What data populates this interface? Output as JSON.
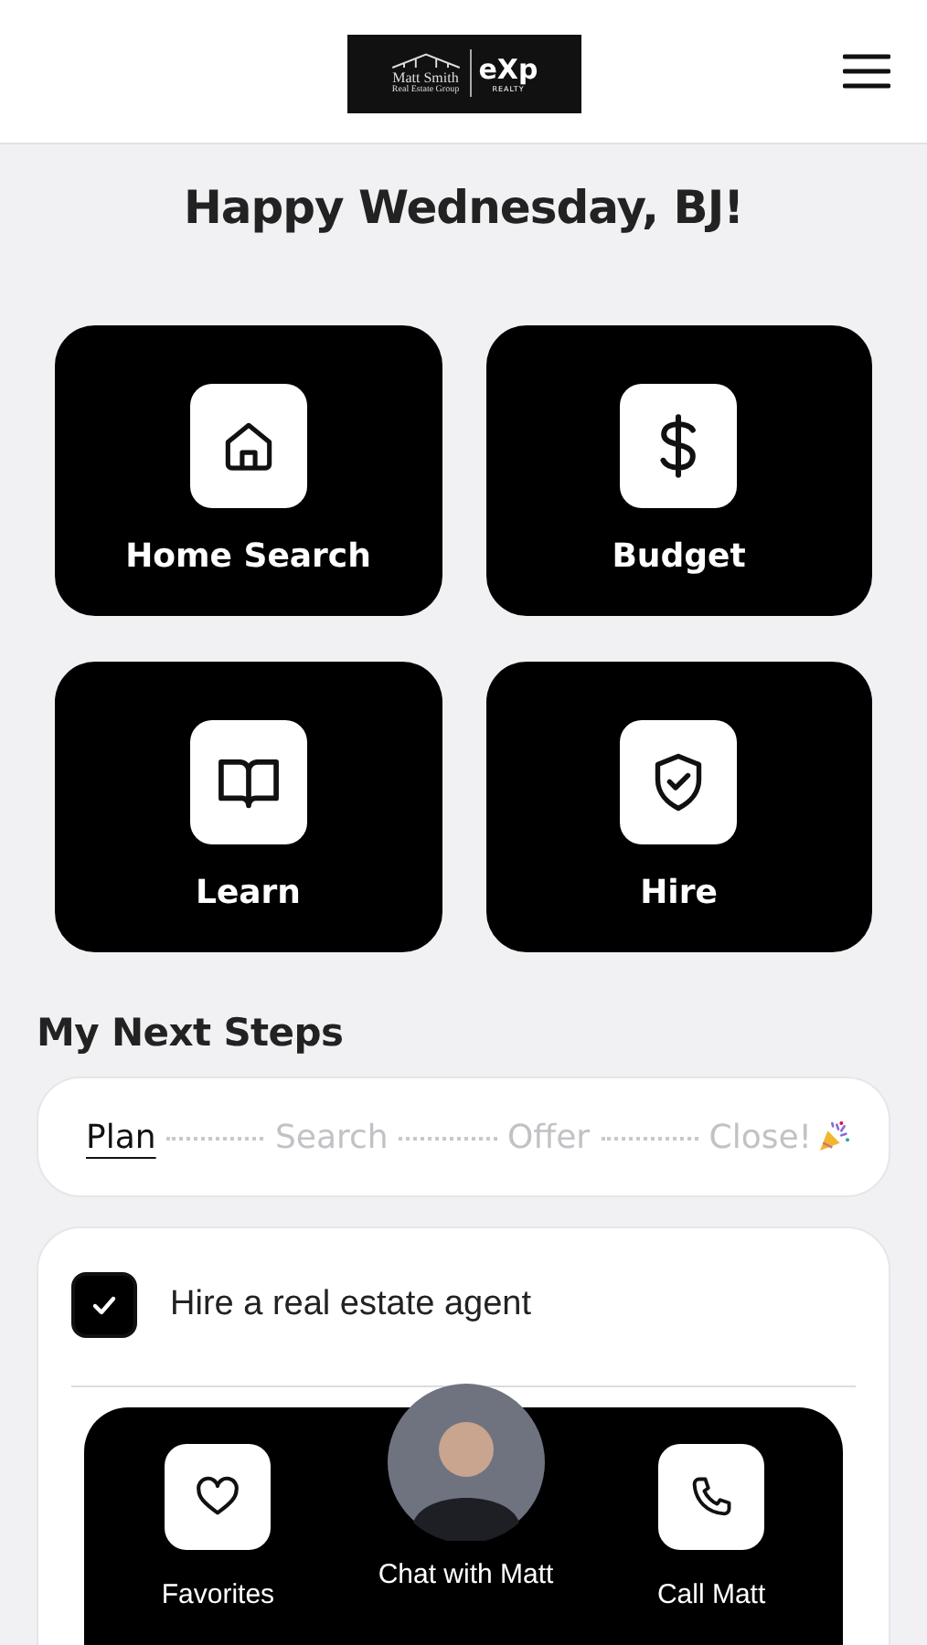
{
  "header": {
    "logo": {
      "name": "Matt Smith",
      "tagline": "Real Estate Group",
      "brand": "eXp",
      "brand_sub": "REALTY"
    }
  },
  "greeting": "Happy Wednesday, BJ!",
  "tiles": [
    {
      "label": "Home Search",
      "kind": "home"
    },
    {
      "label": "Budget",
      "kind": "dollar"
    },
    {
      "label": "Learn",
      "kind": "book"
    },
    {
      "label": "Hire",
      "kind": "shield"
    }
  ],
  "next_steps": {
    "title": "My Next Steps",
    "stages": [
      {
        "label": "Plan",
        "selected": true,
        "kind": "text"
      },
      {
        "label": "Search",
        "selected": false,
        "kind": "text"
      },
      {
        "label": "Offer",
        "selected": false,
        "kind": "text"
      },
      {
        "label": "Close!",
        "selected": false,
        "kind": "party"
      }
    ],
    "tasks": [
      {
        "label": "Hire a real estate agent",
        "checked": true
      }
    ]
  },
  "bottom_bar": [
    {
      "label": "Favorites",
      "kind": "heart"
    },
    {
      "label": "Chat with Matt",
      "kind": "avatar"
    },
    {
      "label": "Call Matt",
      "kind": "phone"
    }
  ]
}
